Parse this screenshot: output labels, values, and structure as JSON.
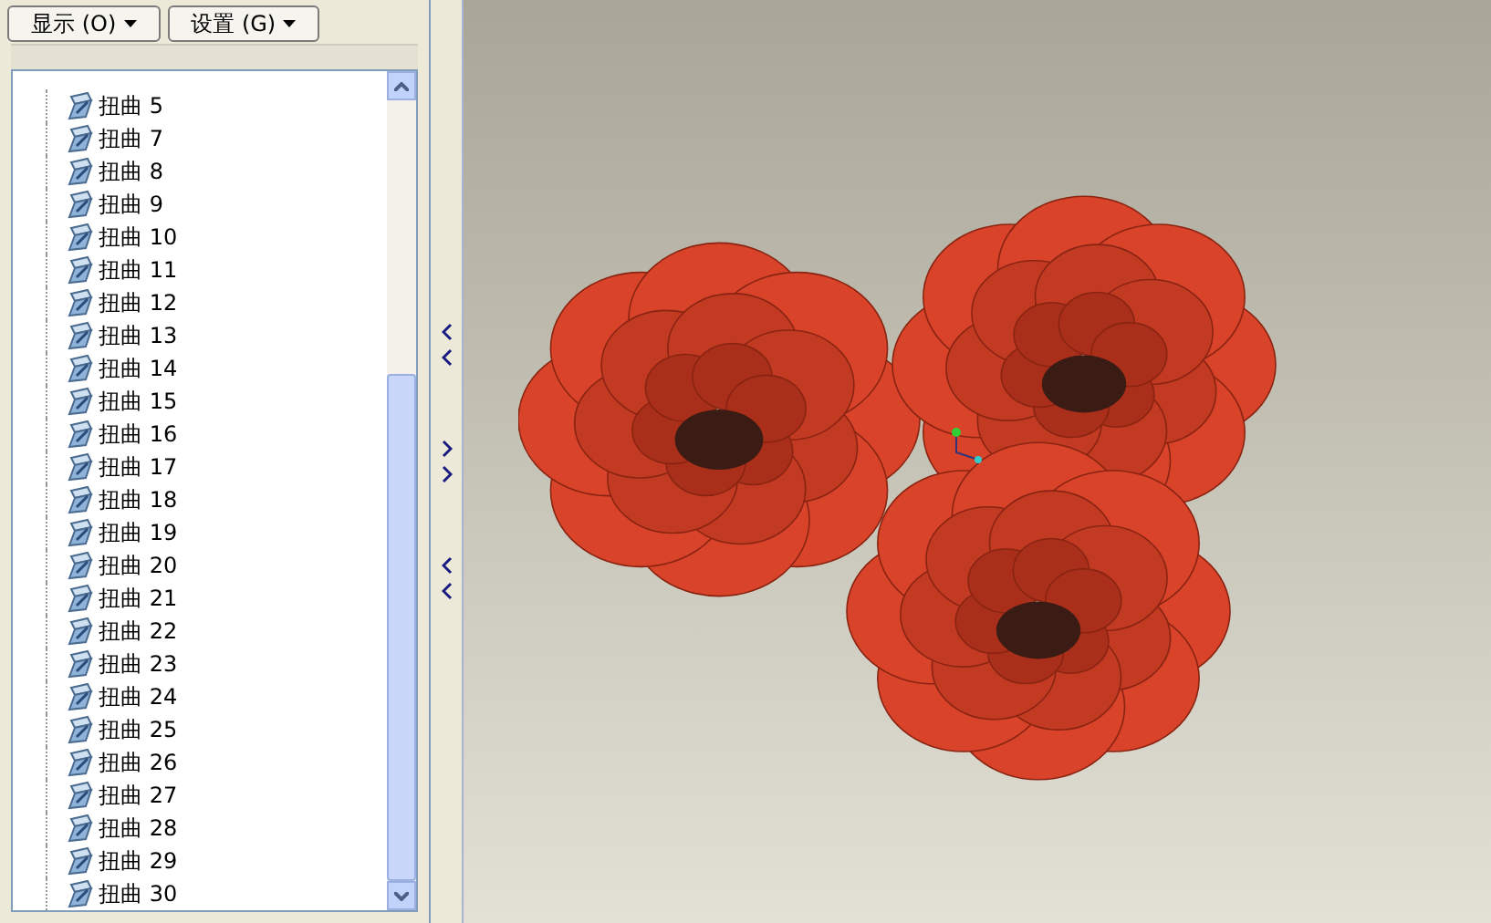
{
  "toolbar": {
    "buttons": [
      {
        "label": "显示 (O)"
      },
      {
        "label": "设置 (G)"
      }
    ]
  },
  "model_tree": {
    "items": [
      {
        "label": "扭曲 5"
      },
      {
        "label": "扭曲 7"
      },
      {
        "label": "扭曲 8"
      },
      {
        "label": "扭曲 9"
      },
      {
        "label": "扭曲 10"
      },
      {
        "label": "扭曲 11"
      },
      {
        "label": "扭曲 12"
      },
      {
        "label": "扭曲 13"
      },
      {
        "label": "扭曲 14"
      },
      {
        "label": "扭曲 15"
      },
      {
        "label": "扭曲 16"
      },
      {
        "label": "扭曲 17"
      },
      {
        "label": "扭曲 18"
      },
      {
        "label": "扭曲 19"
      },
      {
        "label": "扭曲 20"
      },
      {
        "label": "扭曲 21"
      },
      {
        "label": "扭曲 22"
      },
      {
        "label": "扭曲 23"
      },
      {
        "label": "扭曲 24"
      },
      {
        "label": "扭曲 25"
      },
      {
        "label": "扭曲 26"
      },
      {
        "label": "扭曲 27"
      },
      {
        "label": "扭曲 28"
      },
      {
        "label": "扭曲 29"
      },
      {
        "label": "扭曲 30"
      }
    ]
  }
}
